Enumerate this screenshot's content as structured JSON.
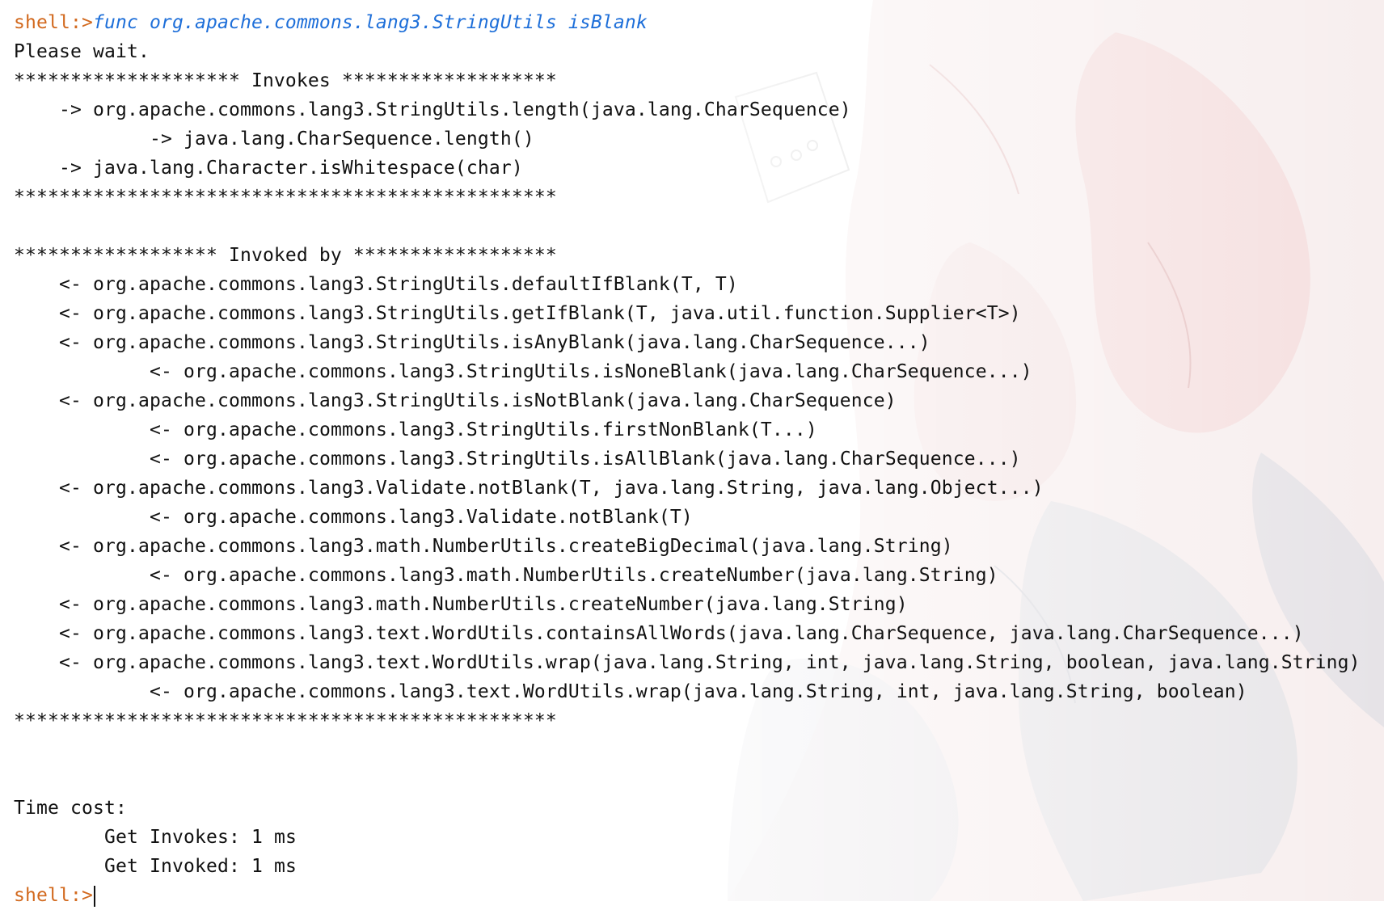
{
  "prompt": "shell:>",
  "command": "func org.apache.commons.lang3.StringUtils isBlank",
  "wait_message": "Please wait.",
  "invokes_header": "******************** Invokes *******************",
  "invokes": [
    {
      "text": "-> org.apache.commons.lang3.StringUtils.length(java.lang.CharSequence)",
      "level": 1
    },
    {
      "text": "-> java.lang.CharSequence.length()",
      "level": 2
    },
    {
      "text": "-> java.lang.Character.isWhitespace(char)",
      "level": 1
    }
  ],
  "separator": "************************************************",
  "invoked_by_header": "****************** Invoked by ******************",
  "invoked_by": [
    {
      "text": "<- org.apache.commons.lang3.StringUtils.defaultIfBlank(T, T)",
      "level": 1
    },
    {
      "text": "<- org.apache.commons.lang3.StringUtils.getIfBlank(T, java.util.function.Supplier<T>)",
      "level": 1
    },
    {
      "text": "<- org.apache.commons.lang3.StringUtils.isAnyBlank(java.lang.CharSequence...)",
      "level": 1
    },
    {
      "text": "<- org.apache.commons.lang3.StringUtils.isNoneBlank(java.lang.CharSequence...)",
      "level": 2
    },
    {
      "text": "<- org.apache.commons.lang3.StringUtils.isNotBlank(java.lang.CharSequence)",
      "level": 1
    },
    {
      "text": "<- org.apache.commons.lang3.StringUtils.firstNonBlank(T...)",
      "level": 2
    },
    {
      "text": "<- org.apache.commons.lang3.StringUtils.isAllBlank(java.lang.CharSequence...)",
      "level": 2
    },
    {
      "text": "<- org.apache.commons.lang3.Validate.notBlank(T, java.lang.String, java.lang.Object...)",
      "level": 1
    },
    {
      "text": "<- org.apache.commons.lang3.Validate.notBlank(T)",
      "level": 2
    },
    {
      "text": "<- org.apache.commons.lang3.math.NumberUtils.createBigDecimal(java.lang.String)",
      "level": 1
    },
    {
      "text": "<- org.apache.commons.lang3.math.NumberUtils.createNumber(java.lang.String)",
      "level": 2
    },
    {
      "text": "<- org.apache.commons.lang3.math.NumberUtils.createNumber(java.lang.String)",
      "level": 1
    },
    {
      "text": "<- org.apache.commons.lang3.text.WordUtils.containsAllWords(java.lang.CharSequence, java.lang.CharSequence...)",
      "level": 1
    },
    {
      "text": "<- org.apache.commons.lang3.text.WordUtils.wrap(java.lang.String, int, java.lang.String, boolean, java.lang.String)",
      "level": 1
    },
    {
      "text": "<- org.apache.commons.lang3.text.WordUtils.wrap(java.lang.String, int, java.lang.String, boolean)",
      "level": 2
    }
  ],
  "time_cost_label": "Time cost:",
  "time_invokes": "Get Invokes: 1 ms",
  "time_invoked": "Get Invoked: 1 ms",
  "colors": {
    "prompt": "#d2691e",
    "command": "#1e6fd9",
    "text": "#111111"
  }
}
